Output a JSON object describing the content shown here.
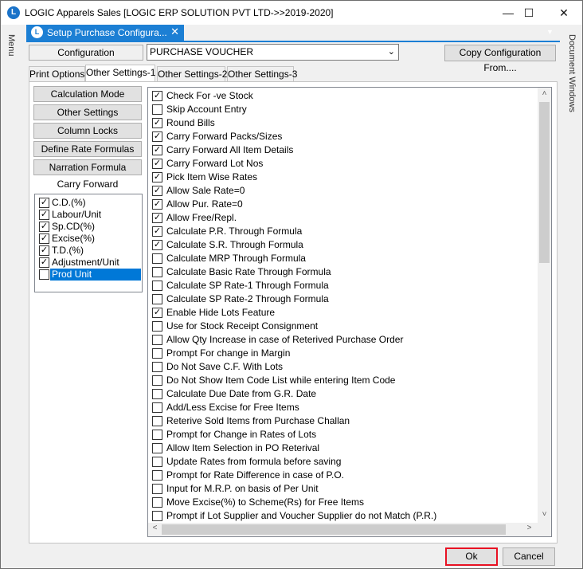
{
  "window": {
    "title": "LOGIC Apparels Sales  [LOGIC ERP SOLUTION PVT LTD->>2019-2020]",
    "minimize": "—",
    "maximize": "☐",
    "close": "✕"
  },
  "rails": {
    "left_label": "Menu",
    "right_label": "Document Windows"
  },
  "doc_tab": {
    "label": "Setup Purchase Configura...",
    "close": "✕",
    "icon": "logic-app-icon"
  },
  "config": {
    "label": "Configuration",
    "value": "PURCHASE VOUCHER",
    "copy_button": "Copy Configuration From...."
  },
  "tabs": [
    {
      "label": "Print Options"
    },
    {
      "label": "Other Settings-1",
      "active": true
    },
    {
      "label": "Other Settings-2"
    },
    {
      "label": "Other Settings-3"
    }
  ],
  "side_buttons": [
    {
      "label": "Calculation Mode"
    },
    {
      "label": "Other Settings"
    },
    {
      "label": "Column Locks"
    },
    {
      "label": "Define Rate Formulas"
    },
    {
      "label": "Narration Formula"
    }
  ],
  "carry_forward": {
    "title": "Carry Forward",
    "items": [
      {
        "label": "C.D.(%)",
        "checked": true
      },
      {
        "label": "Labour/Unit",
        "checked": true
      },
      {
        "label": "Sp.CD(%)",
        "checked": true
      },
      {
        "label": "Excise(%)",
        "checked": true
      },
      {
        "label": "T.D.(%)",
        "checked": true
      },
      {
        "label": "Adjustment/Unit",
        "checked": true
      },
      {
        "label": "Prod Unit",
        "checked": false,
        "selected": true
      }
    ]
  },
  "options": [
    {
      "label": "Check For -ve Stock",
      "checked": true
    },
    {
      "label": "Skip Account Entry",
      "checked": false
    },
    {
      "label": "Round Bills",
      "checked": true
    },
    {
      "label": "Carry Forward Packs/Sizes",
      "checked": true
    },
    {
      "label": "Carry Forward All Item Details",
      "checked": true
    },
    {
      "label": "Carry Forward Lot Nos",
      "checked": true
    },
    {
      "label": "Pick Item Wise Rates",
      "checked": true
    },
    {
      "label": "Allow Sale Rate=0",
      "checked": true
    },
    {
      "label": "Allow Pur. Rate=0",
      "checked": true
    },
    {
      "label": "Allow Free/Repl.",
      "checked": true
    },
    {
      "label": "Calculate P.R. Through Formula",
      "checked": true
    },
    {
      "label": "Calculate S.R. Through Formula",
      "checked": true
    },
    {
      "label": "Calculate MRP Through Formula",
      "checked": false
    },
    {
      "label": "Calculate Basic Rate Through Formula",
      "checked": false
    },
    {
      "label": "Calculate SP Rate-1 Through Formula",
      "checked": false
    },
    {
      "label": "Calculate SP Rate-2 Through Formula",
      "checked": false
    },
    {
      "label": "Enable Hide Lots Feature",
      "checked": true
    },
    {
      "label": "Use for Stock Receipt Consignment",
      "checked": false
    },
    {
      "label": "Allow Qty Increase in case of Reterived Purchase Order",
      "checked": false
    },
    {
      "label": "Prompt For change in Margin",
      "checked": false
    },
    {
      "label": "Do Not Save C.F. With Lots",
      "checked": false
    },
    {
      "label": "Do Not Show Item Code List while entering Item Code",
      "checked": false
    },
    {
      "label": "Calculate Due Date from G.R. Date",
      "checked": false
    },
    {
      "label": "Add/Less Excise for Free Items",
      "checked": false
    },
    {
      "label": "Reterive Sold Items from Purchase Challan",
      "checked": false
    },
    {
      "label": "Prompt for Change in Rates of Lots",
      "checked": false
    },
    {
      "label": "Allow Item Selection in PO Reterival",
      "checked": false
    },
    {
      "label": "Update Rates from formula before saving",
      "checked": false
    },
    {
      "label": "Prompt for Rate Difference in case of P.O.",
      "checked": false
    },
    {
      "label": "Input for M.R.P. on basis of Per Unit",
      "checked": false
    },
    {
      "label": "Move Excise(%) to Scheme(Rs) for Free Items",
      "checked": false
    },
    {
      "label": "Prompt if Lot Supplier and Voucher Supplier do not Match (P.R.)",
      "checked": false
    }
  ],
  "buttons": {
    "ok": "Ok",
    "cancel": "Cancel"
  }
}
